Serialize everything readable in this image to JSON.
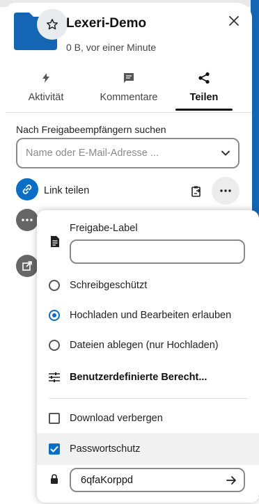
{
  "header": {
    "title": "Lexeri-Demo",
    "subtitle": "0 B, vor einer Minute"
  },
  "tabs": [
    {
      "label": "Aktivität",
      "icon": "lightning-icon"
    },
    {
      "label": "Kommentare",
      "icon": "comment-icon"
    },
    {
      "label": "Teilen",
      "icon": "share-icon",
      "active": true
    }
  ],
  "search": {
    "label": "Nach Freigabeempfängern suchen",
    "placeholder": "Name oder E-Mail-Adresse ..."
  },
  "share_link": {
    "label": "Link teilen"
  },
  "popover": {
    "share_label_title": "Freigabe-Label",
    "share_label_value": "",
    "options": [
      {
        "label": "Schreibgeschützt",
        "selected": false
      },
      {
        "label": "Hochladen und Bearbeiten erlauben",
        "selected": true
      },
      {
        "label": "Dateien ablegen (nur Hochladen)",
        "selected": false
      }
    ],
    "custom_permissions": "Benutzerdefinierte Berecht...",
    "hide_download": {
      "label": "Download verbergen",
      "checked": false
    },
    "password_protect": {
      "label": "Passwortschutz",
      "checked": true
    },
    "password_value": "6qfaKorppd"
  },
  "colors": {
    "accent": "#0b6ec6",
    "folder": "#1565b5",
    "avatar_dark": "#666666"
  }
}
